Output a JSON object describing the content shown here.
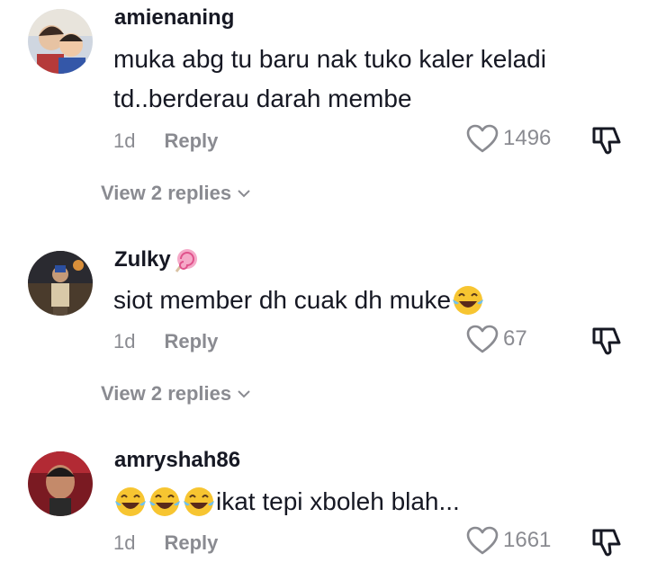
{
  "comments": [
    {
      "username": "amienaning",
      "text_line1": "muka abg tu baru nak tuko kaler keladi",
      "text_line2": "td..berderau darah membe",
      "time": "1d",
      "reply_label": "Reply",
      "likes": "1496",
      "view_replies": "View 2 replies"
    },
    {
      "username": "Zulky",
      "username_emoji": "lollipop",
      "text": "siot member dh cuak dh muke",
      "text_emoji": "face-with-tears-of-joy",
      "time": "1d",
      "reply_label": "Reply",
      "likes": "67",
      "view_replies": "View 2 replies"
    },
    {
      "username": "amryshah86",
      "text": "ikat tepi xboleh blah...",
      "text_emoji": "face-with-tears-of-joy x3",
      "time": "1d",
      "reply_label": "Reply",
      "likes": "1661"
    }
  ]
}
